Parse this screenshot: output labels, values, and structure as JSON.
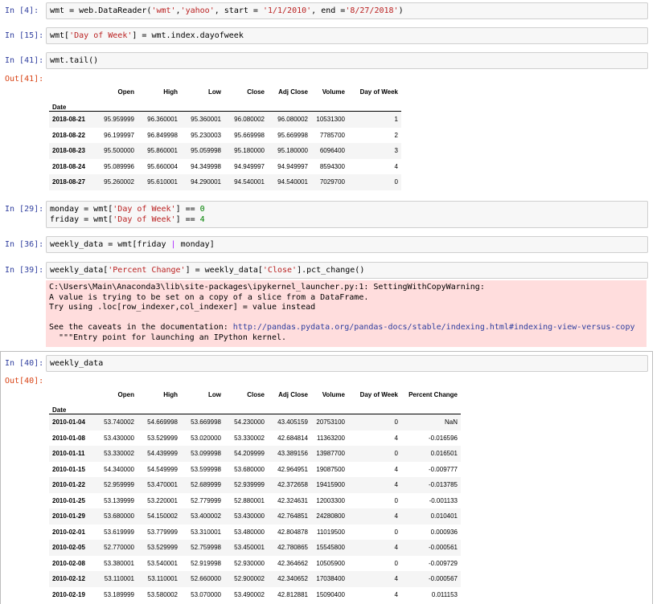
{
  "cells": [
    {
      "prompt": "In [4]:",
      "code": [
        "wmt = web.DataReader(",
        {
          "s": "'wmt'"
        },
        ",",
        {
          "s": "'yahoo'"
        },
        ", start = ",
        {
          "s": "'1/1/2010'"
        },
        ", end =",
        {
          "s": "'8/27/2018'"
        },
        ")"
      ]
    },
    {
      "prompt": "In [15]:",
      "code": [
        "wmt[",
        {
          "s": "'Day of Week'"
        },
        "] = wmt.index.dayofweek"
      ]
    },
    {
      "prompt": "In [41]:",
      "code": [
        "wmt.tail()"
      ]
    },
    {
      "prompt": "In [29]:",
      "code": [
        "monday = wmt[",
        {
          "s": "'Day of Week'"
        },
        "] == ",
        {
          "n": "0"
        },
        "\nfriday = wmt[",
        {
          "s": "'Day of Week'"
        },
        "] == ",
        {
          "n": "4"
        }
      ]
    },
    {
      "prompt": "In [36]:",
      "code": [
        "weekly_data = wmt[friday ",
        {
          "o": "|"
        },
        " monday]"
      ]
    },
    {
      "prompt": "In [39]:",
      "code": [
        "weekly_data[",
        {
          "s": "'Percent Change'"
        },
        "] = weekly_data[",
        {
          "s": "'Close'"
        },
        "].pct_change()"
      ]
    },
    {
      "prompt": "In [40]:",
      "code": [
        "weekly_data"
      ]
    }
  ],
  "out41": {
    "prompt": "Out[41]:",
    "columns": [
      "Open",
      "High",
      "Low",
      "Close",
      "Adj Close",
      "Volume",
      "Day of Week"
    ],
    "index_name": "Date",
    "rows": [
      [
        "2018-08-21",
        "95.959999",
        "96.360001",
        "95.360001",
        "96.080002",
        "96.080002",
        "10531300",
        "1"
      ],
      [
        "2018-08-22",
        "96.199997",
        "96.849998",
        "95.230003",
        "95.669998",
        "95.669998",
        "7785700",
        "2"
      ],
      [
        "2018-08-23",
        "95.500000",
        "95.860001",
        "95.059998",
        "95.180000",
        "95.180000",
        "6096400",
        "3"
      ],
      [
        "2018-08-24",
        "95.089996",
        "95.660004",
        "94.349998",
        "94.949997",
        "94.949997",
        "8594300",
        "4"
      ],
      [
        "2018-08-27",
        "95.260002",
        "95.610001",
        "94.290001",
        "94.540001",
        "94.540001",
        "7029700",
        "0"
      ]
    ]
  },
  "warning": {
    "line1": "C:\\Users\\Main\\Anaconda3\\lib\\site-packages\\ipykernel_launcher.py:1: SettingWithCopyWarning:",
    "line2": "A value is trying to be set on a copy of a slice from a DataFrame.",
    "line3": "Try using .loc[row_indexer,col_indexer] = value instead",
    "line4_prefix": "See the caveats in the documentation: ",
    "link": "http://pandas.pydata.org/pandas-docs/stable/indexing.html#indexing-view-versus-copy",
    "line5": "  \"\"\"Entry point for launching an IPython kernel."
  },
  "out40": {
    "prompt": "Out[40]:",
    "columns": [
      "Open",
      "High",
      "Low",
      "Close",
      "Adj Close",
      "Volume",
      "Day of Week",
      "Percent Change"
    ],
    "index_name": "Date",
    "rows": [
      [
        "2010-01-04",
        "53.740002",
        "54.669998",
        "53.669998",
        "54.230000",
        "43.405159",
        "20753100",
        "0",
        "NaN"
      ],
      [
        "2010-01-08",
        "53.430000",
        "53.529999",
        "53.020000",
        "53.330002",
        "42.684814",
        "11363200",
        "4",
        "-0.016596"
      ],
      [
        "2010-01-11",
        "53.330002",
        "54.439999",
        "53.099998",
        "54.209999",
        "43.389156",
        "13987700",
        "0",
        "0.016501"
      ],
      [
        "2010-01-15",
        "54.340000",
        "54.549999",
        "53.599998",
        "53.680000",
        "42.964951",
        "19087500",
        "4",
        "-0.009777"
      ],
      [
        "2010-01-22",
        "52.959999",
        "53.470001",
        "52.689999",
        "52.939999",
        "42.372658",
        "19415900",
        "4",
        "-0.013785"
      ],
      [
        "2010-01-25",
        "53.139999",
        "53.220001",
        "52.779999",
        "52.880001",
        "42.324631",
        "12003300",
        "0",
        "-0.001133"
      ],
      [
        "2010-01-29",
        "53.680000",
        "54.150002",
        "53.400002",
        "53.430000",
        "42.764851",
        "24280800",
        "4",
        "0.010401"
      ],
      [
        "2010-02-01",
        "53.619999",
        "53.779999",
        "53.310001",
        "53.480000",
        "42.804878",
        "11019500",
        "0",
        "0.000936"
      ],
      [
        "2010-02-05",
        "52.770000",
        "53.529999",
        "52.759998",
        "53.450001",
        "42.780865",
        "15545800",
        "4",
        "-0.000561"
      ],
      [
        "2010-02-08",
        "53.380001",
        "53.540001",
        "52.919998",
        "52.930000",
        "42.364662",
        "10505900",
        "0",
        "-0.009729"
      ],
      [
        "2010-02-12",
        "53.110001",
        "53.110001",
        "52.660000",
        "52.900002",
        "42.340652",
        "17038400",
        "4",
        "-0.000567"
      ],
      [
        "2010-02-19",
        "53.189999",
        "53.580002",
        "53.070000",
        "53.490002",
        "42.812881",
        "15090400",
        "4",
        "0.011153"
      ]
    ]
  }
}
